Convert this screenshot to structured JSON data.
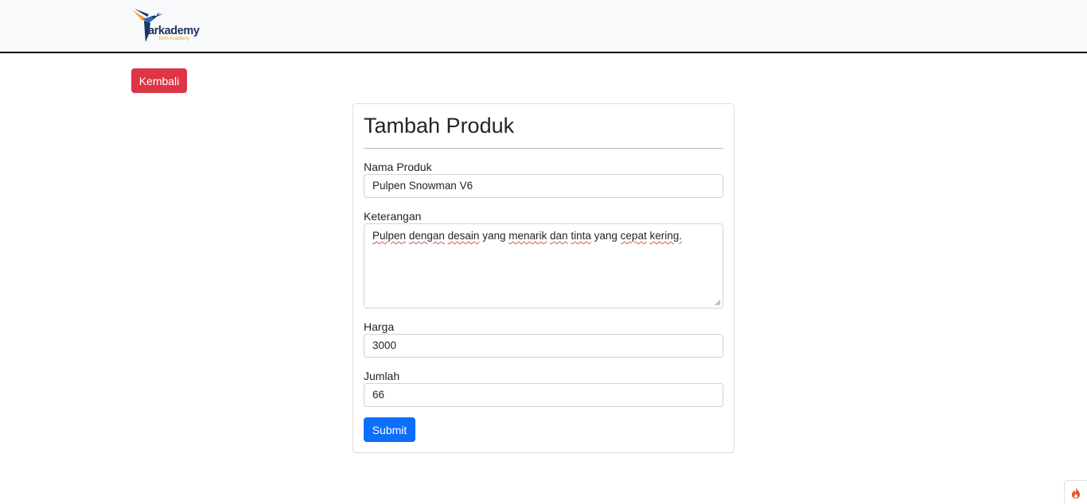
{
  "brand": {
    "name": "arkademy",
    "tagline": "Tech Academy",
    "logo_icon": "hummingbird-logo-icon"
  },
  "actions": {
    "back_label": "Kembali"
  },
  "form": {
    "title": "Tambah Produk",
    "fields": {
      "name": {
        "label": "Nama Produk",
        "value": "Pulpen Snowman V6"
      },
      "description": {
        "label": "Keterangan",
        "value_words": [
          "Pulpen",
          "dengan",
          "desain",
          "yang",
          "menarik",
          "dan",
          "tinta",
          "yang",
          "cepat",
          "kering."
        ]
      },
      "price": {
        "label": "Harga",
        "value": "3000"
      },
      "quantity": {
        "label": "Jumlah",
        "value": "66"
      }
    },
    "submit_label": "Submit"
  },
  "corner_widget": {
    "icon": "flame-icon",
    "color": "#e8542b"
  },
  "colors": {
    "danger": "#dc3545",
    "primary": "#0d6efd",
    "navbar_bg": "#f8f9fa",
    "brand_navy": "#1d3461",
    "brand_orange": "#f5a623"
  }
}
